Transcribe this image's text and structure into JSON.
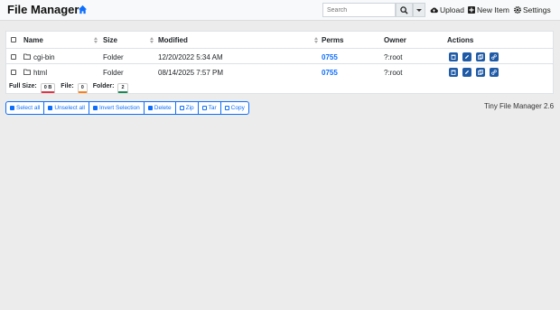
{
  "header": {
    "brand": "File Manager",
    "search_placeholder": "Search",
    "upload_label": "Upload",
    "new_item_label": "New Item",
    "settings_label": "Settings"
  },
  "table": {
    "columns": [
      "Name",
      "Size",
      "Modified",
      "Perms",
      "Owner",
      "Actions"
    ],
    "rows": [
      {
        "name": "cgi-bin",
        "size": "Folder",
        "modified": "12/20/2022 5:34 AM",
        "perms": "0755",
        "owner": "?:root"
      },
      {
        "name": "html",
        "size": "Folder",
        "modified": "08/14/2025 7:57 PM",
        "perms": "0755",
        "owner": "?:root"
      }
    ]
  },
  "stats": {
    "full_size_label": "Full Size:",
    "full_size_value": "0 B",
    "file_label": "File:",
    "file_value": "0",
    "folder_label": "Folder:",
    "folder_value": "2"
  },
  "buttons": {
    "select_all": "Select all",
    "unselect_all": "Unselect all",
    "invert_selection": "Invert Selection",
    "delete": "Delete",
    "zip": "Zip",
    "tar": "Tar",
    "copy": "Copy"
  },
  "footer": {
    "version": "Tiny File Manager 2.6"
  },
  "colors": {
    "accent": "#0d6efd",
    "action_button": "#1f5aa6",
    "background": "#ececec"
  }
}
